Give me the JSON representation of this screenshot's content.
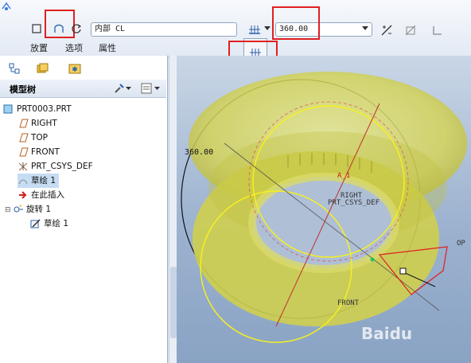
{
  "toolbar": {
    "tabs": [
      "放置",
      "选项",
      "属性"
    ],
    "axis_field": "内部 CL",
    "angle_value": "360.00"
  },
  "dropdown": {
    "items": [
      "variable-angle-icon",
      "symmetric-icon",
      "to-selected-icon"
    ]
  },
  "model_tree": {
    "title": "模型树",
    "items": [
      {
        "label": "PRT0003.PRT",
        "icon": "part-icon"
      },
      {
        "label": "RIGHT",
        "icon": "datum-plane-icon"
      },
      {
        "label": "TOP",
        "icon": "datum-plane-icon"
      },
      {
        "label": "FRONT",
        "icon": "datum-plane-icon"
      },
      {
        "label": "PRT_CSYS_DEF",
        "icon": "csys-icon"
      },
      {
        "label": "草绘 1",
        "icon": "sketch-icon"
      },
      {
        "label": "在此插入",
        "icon": "insert-here-icon"
      },
      {
        "label": "旋转 1",
        "icon": "revolve-icon"
      },
      {
        "label": "草绘 1",
        "icon": "sketch-icon"
      }
    ]
  },
  "viewport": {
    "dimension_label": "360.00",
    "datum_labels": {
      "a1": "A_1",
      "right": "RIGHT",
      "csys": "PRT_CSYS_DEF",
      "front": "FRONT",
      "top": "OP"
    },
    "watermark": "Baidu"
  }
}
